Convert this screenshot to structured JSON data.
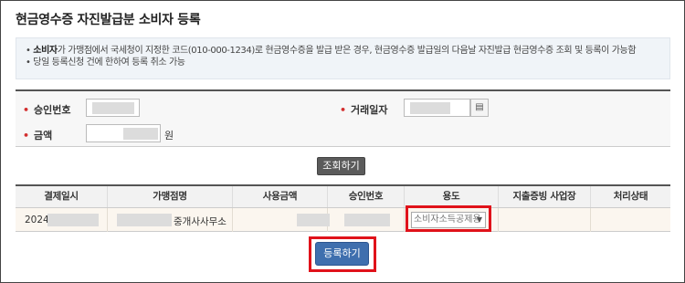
{
  "page_title": "현금영수증 자진발급분 소비자 등록",
  "notice": {
    "line1_bold": "소비자",
    "line1_rest": "가 가맹점에서 국세청이 지정한 코드(010-000-1234)로 현금영수증을 발급 받은 경우, 현금영수증 발급일의 다음날 자진발급 현금영수증 조회 및 등록이 가능함",
    "line2": "당일 등록신청 건에 한하여 등록 취소 가능"
  },
  "form": {
    "approval_label": "승인번호",
    "date_label": "거래일자",
    "amount_label": "금액",
    "amount_unit": "원",
    "calendar_icon": "calendar-icon"
  },
  "search_button": "조회하기",
  "table": {
    "headers": [
      "결제일시",
      "가맹점명",
      "사용금액",
      "승인번호",
      "용도",
      "지출증빙 사업장",
      "처리상태"
    ],
    "row": {
      "date_prefix": "2024-",
      "merchant_suffix": "중개사사무소",
      "usage_selected": "소비자소득공제용"
    }
  },
  "register_button": "등록하기",
  "colors": {
    "highlight": "#e0121a",
    "primary_button": "#3f6fae",
    "search_button": "#5b5b5b"
  }
}
